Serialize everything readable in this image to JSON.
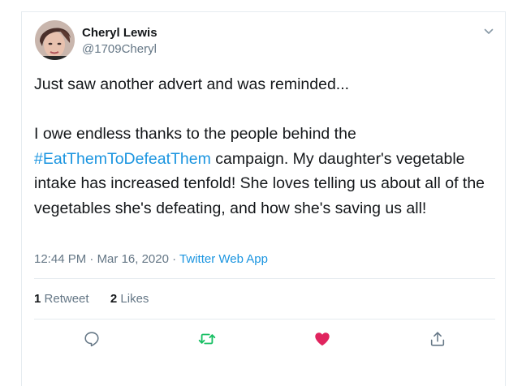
{
  "user": {
    "display_name": "Cheryl Lewis",
    "handle": "@1709Cheryl"
  },
  "tweet": {
    "line1": "Just saw another advert and was reminded...",
    "para2_before": "I owe endless thanks to the people behind the",
    "hashtag": "#EatThemToDefeatThem",
    "para2_after": "campaign. My daughter's vegetable intake has increased tenfold! She loves telling us about all of the vegetables she's defeating, and how she's saving us all!"
  },
  "meta": {
    "time": "12:44 PM",
    "date": "Mar 16, 2020",
    "separator": "·",
    "source": "Twitter Web App"
  },
  "stats": {
    "retweets_count": "1",
    "retweets_label": "Retweet",
    "likes_count": "2",
    "likes_label": "Likes"
  },
  "actions": {
    "reply_icon": "speech-bubble-icon",
    "retweet_icon": "retweet-arrows-icon",
    "like_icon": "heart-icon",
    "share_icon": "share-upload-icon"
  },
  "colors": {
    "link": "#1b95e0",
    "retweet_active": "#17bf63",
    "like_active": "#e0245e",
    "secondary_text": "#657786",
    "border": "#e6ecf0"
  }
}
